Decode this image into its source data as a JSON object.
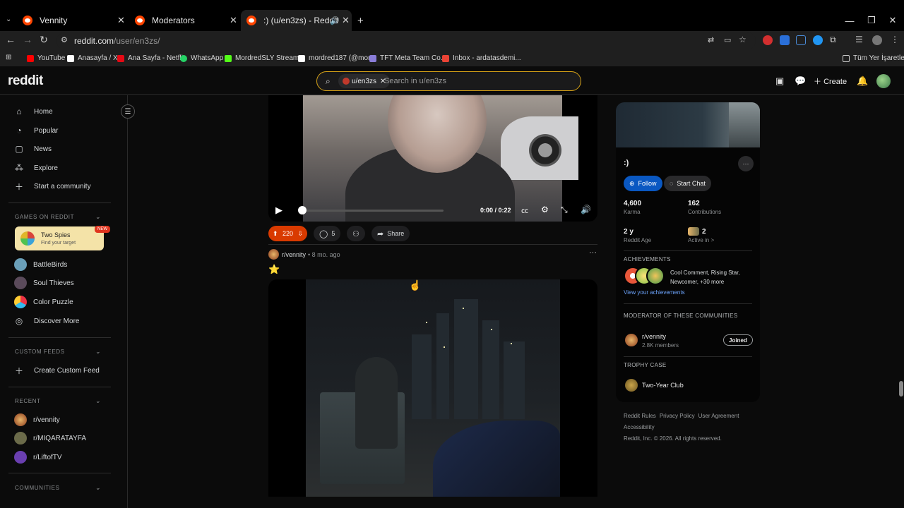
{
  "browser": {
    "tabs": [
      {
        "title": "Vennity"
      },
      {
        "title": "Moderators"
      },
      {
        "title": ":) (u/en3zs) - Reddit"
      }
    ],
    "url_host": "reddit.com",
    "url_path": "/user/en3zs/",
    "bookmarks": [
      {
        "label": "YouTube",
        "color": "#ff0000"
      },
      {
        "label": "Anasayfa / X",
        "color": "#ffffff"
      },
      {
        "label": "Ana Sayfa - Netflix",
        "color": "#e50914"
      },
      {
        "label": "WhatsApp",
        "color": "#25d366"
      },
      {
        "label": "MordredSLY Stream...",
        "color": "#53fc18"
      },
      {
        "label": "mordred187 (@mor...",
        "color": "#ffffff"
      },
      {
        "label": "TFT Meta Team Co...",
        "color": "#8a7dd8"
      },
      {
        "label": "Inbox - ardatasdemi...",
        "color": "#ea4335"
      }
    ],
    "all_bookmarks": "Tüm Yer İşaretleri"
  },
  "header": {
    "logo": "reddit",
    "search_chip": "u/en3zs",
    "search_placeholder": "Search in u/en3zs",
    "create_label": "Create"
  },
  "sidebar": {
    "nav": [
      {
        "label": "Home",
        "icon": "home-icon"
      },
      {
        "label": "Popular",
        "icon": "popular-icon"
      },
      {
        "label": "News",
        "icon": "news-icon"
      },
      {
        "label": "Explore",
        "icon": "explore-icon"
      },
      {
        "label": "Start a community",
        "icon": "plus-icon"
      }
    ],
    "games_heading": "GAMES ON REDDIT",
    "featured_game": {
      "title": "Two Spies",
      "subtitle": "Find your target",
      "badge": "NEW"
    },
    "games": [
      {
        "label": "BattleBirds"
      },
      {
        "label": "Soul Thieves"
      },
      {
        "label": "Color Puzzle"
      },
      {
        "label": "Discover More"
      }
    ],
    "custom_feeds_heading": "CUSTOM FEEDS",
    "create_feed": "Create Custom Feed",
    "recent_heading": "RECENT",
    "recent": [
      {
        "label": "r/vennity"
      },
      {
        "label": "r/MIQARATAYFA"
      },
      {
        "label": "r/LiftofTV"
      }
    ],
    "communities_heading": "COMMUNITIES"
  },
  "post1": {
    "time": "0:00 / 0:22",
    "votes": "220",
    "comments": "5",
    "share": "Share"
  },
  "post2": {
    "subreddit": "r/vennity",
    "age": "• 8 mo. ago",
    "title": "⭐"
  },
  "profile": {
    "username": ":)",
    "follow": "Follow",
    "start_chat": "Start Chat",
    "karma_value": "4,600",
    "karma_label": "Karma",
    "contrib_value": "162",
    "contrib_label": "Contributions",
    "age_value": "2 y",
    "age_label": "Reddit Age",
    "active_value": "2",
    "active_label": "Active in >",
    "achievements_heading": "ACHIEVEMENTS",
    "achievements_text": "Cool Comment, Rising Star, Newcomer, +30 more",
    "achievements_link": "View your achievements",
    "moderator_heading": "MODERATOR OF THESE COMMUNITIES",
    "mod_community": "r/vennity",
    "mod_members": "2.8K members",
    "joined": "Joined",
    "trophy_heading": "TROPHY CASE",
    "trophy": "Two-Year Club"
  },
  "footer": {
    "rules": "Reddit Rules",
    "privacy": "Privacy Policy",
    "agreement": "User Agreement",
    "accessibility": "Accessibility",
    "copyright": "Reddit, Inc. © 2026. All rights reserved."
  },
  "colors": {
    "accent_vote": "#d93a00",
    "follow_blue": "#0a58c2",
    "search_border": "#d4a017"
  }
}
